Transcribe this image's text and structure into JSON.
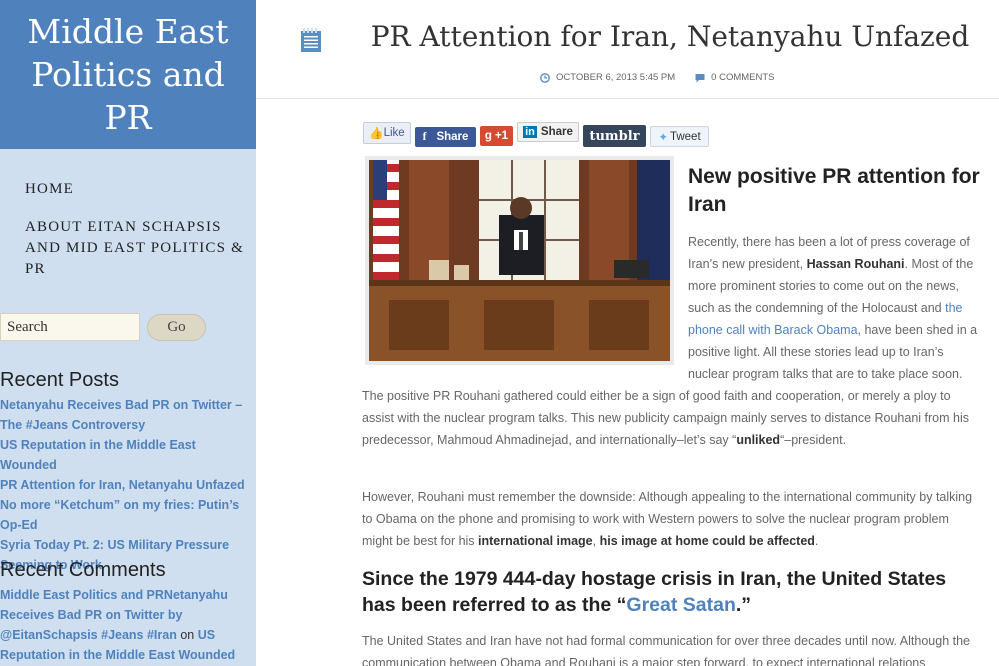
{
  "site": {
    "title": "Middle East Politics and PR"
  },
  "nav": {
    "items": [
      {
        "label": "HOME"
      },
      {
        "label": "ABOUT EITAN SCHAPSIS AND MID EAST POLITICS & PR"
      }
    ]
  },
  "search": {
    "placeholder": "Search",
    "value": "Search",
    "button_label": "Go"
  },
  "recent_posts": {
    "title": "Recent Posts",
    "items": [
      {
        "label": "Netanyahu Receives Bad PR on Twitter – The #Jeans Controversy"
      },
      {
        "label": "US Reputation in the Middle East Wounded"
      },
      {
        "label": "PR Attention for Iran, Netanyahu Unfazed"
      },
      {
        "label": "No more “Ketchum” on my fries: Putin’s Op-Ed"
      },
      {
        "label": "Syria Today Pt. 2: US Military Pressure Seeming to Work"
      }
    ]
  },
  "recent_comments": {
    "title": "Recent Comments",
    "author": "Middle East Politics and PRNetanyahu Receives Bad PR on Twitter by @EitanSchapsis #Jeans #Iran",
    "on": "on",
    "post": "US Reputation in the Middle East Wounded"
  },
  "post": {
    "title": "PR Attention for Iran, Netanyahu Unfazed",
    "date": "OCTOBER 6, 2013 5:45 PM",
    "comments": "0 COMMENTS",
    "heading1": "New positive PR attention for Iran",
    "p1": {
      "a": "Recently, there has been a lot of press coverage of Iran’s new president, ",
      "b": "Hassan Rouhani",
      "c": ". Most of the more prominent stories to come out on the news, such as the condemning of the Holocaust and ",
      "link": "the phone call with Barack Obama",
      "d": ", have been shed in a positive light. All these stories lead up to Iran’s nuclear program talks that are to take place soon. The positive PR Rouhani gathered could either be a sign of good faith and cooperation, or merely a ploy to assist with the nuclear program talks. This new publicity campaign mainly serves to distance Rouhani from his predecessor, Mahmoud Ahmadinejad, and internationally–let’s say “",
      "e": "unliked",
      "f": "“–president."
    },
    "p2": {
      "a": "However, Rouhani must remember the downside: Although appealing to the international community by talking to Obama on the phone and promising to work with Western powers to solve the nuclear program problem might be best for his ",
      "b": "international image",
      "c": ", ",
      "d": "his image at home could be affected",
      "e": "."
    },
    "heading2": {
      "a": "Since the 1979 444-day hostage crisis in Iran, the United States has been referred to as the “",
      "link": "Great Satan",
      "b": ".”"
    },
    "p3": "The United States and Iran have not had formal communication for over three decades until now. Although the communication between Obama and Rouhani is a major step forward, to expect international relations"
  },
  "share": {
    "like": "Like",
    "facebook": "Share",
    "gplus": "+1",
    "linkedin": "Share",
    "tumblr": "tumblr",
    "tweet": "Tweet"
  },
  "colors": {
    "sidebar_bg": "#cfdff0",
    "title_bg": "#4f82bd",
    "link": "#4f82bd"
  },
  "icons": {
    "post": "notepad-icon",
    "date": "clock-icon",
    "comments": "speech-bubble-icon"
  }
}
